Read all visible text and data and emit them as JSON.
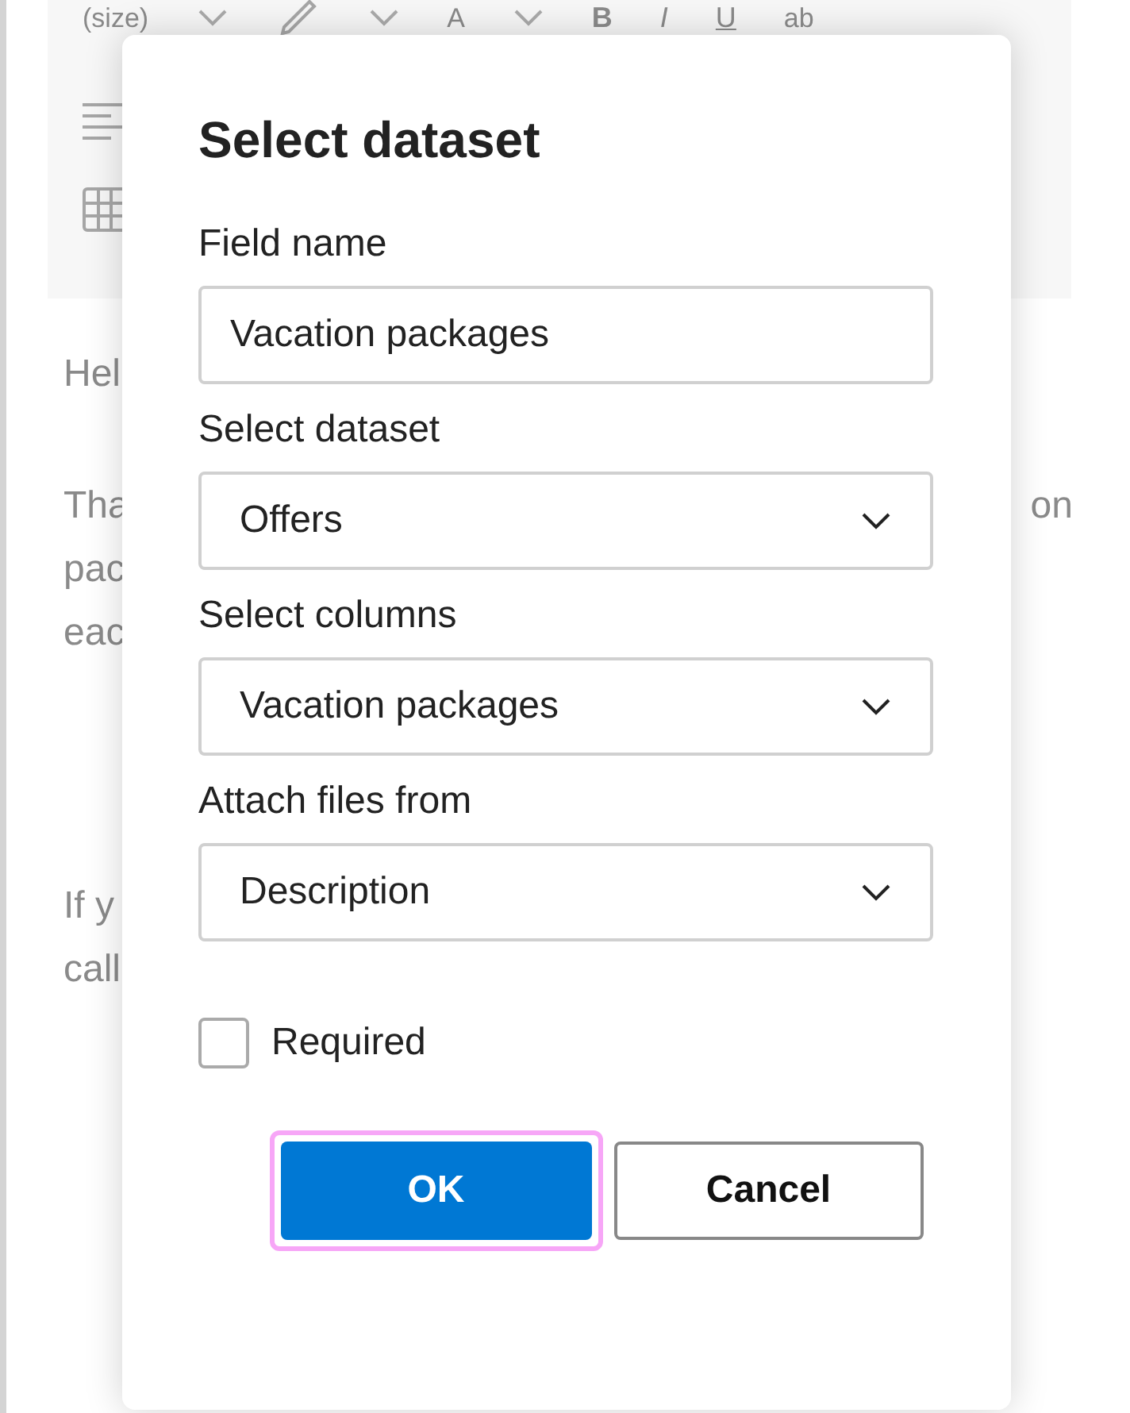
{
  "toolbar": {
    "items": [
      {
        "kind": "text",
        "label": "(size)"
      },
      {
        "kind": "chevron"
      },
      {
        "kind": "pen"
      },
      {
        "kind": "chevron"
      },
      {
        "kind": "text",
        "label": "A"
      },
      {
        "kind": "chevron"
      },
      {
        "kind": "bold",
        "label": "B"
      },
      {
        "kind": "italic",
        "label": "I"
      },
      {
        "kind": "underline",
        "label": "U"
      },
      {
        "kind": "text",
        "label": "ab"
      }
    ]
  },
  "body": {
    "paragraphs": [
      {
        "lines": [
          {
            "left": "Hel"
          }
        ]
      },
      {
        "lines": [
          {
            "left": "Tha",
            "right": "on"
          },
          {
            "left": "pac"
          },
          {
            "left": "eac"
          }
        ]
      },
      {
        "lines": [
          {
            "left": "If y"
          },
          {
            "left": "call"
          }
        ]
      }
    ]
  },
  "dialog": {
    "title": "Select dataset",
    "fields": [
      {
        "kind": "text",
        "label": "Field name",
        "value": "Vacation packages"
      },
      {
        "kind": "select",
        "label": "Select dataset",
        "value": "Offers"
      },
      {
        "kind": "select",
        "label": "Select columns",
        "value": "Vacation packages"
      },
      {
        "kind": "select",
        "label": "Attach files from",
        "value": "Description"
      }
    ],
    "required": {
      "label": "Required",
      "checked": false
    },
    "buttons": [
      {
        "kind": "primary",
        "label": "OK",
        "focused": true
      },
      {
        "kind": "secondary",
        "label": "Cancel",
        "focused": false
      }
    ]
  }
}
